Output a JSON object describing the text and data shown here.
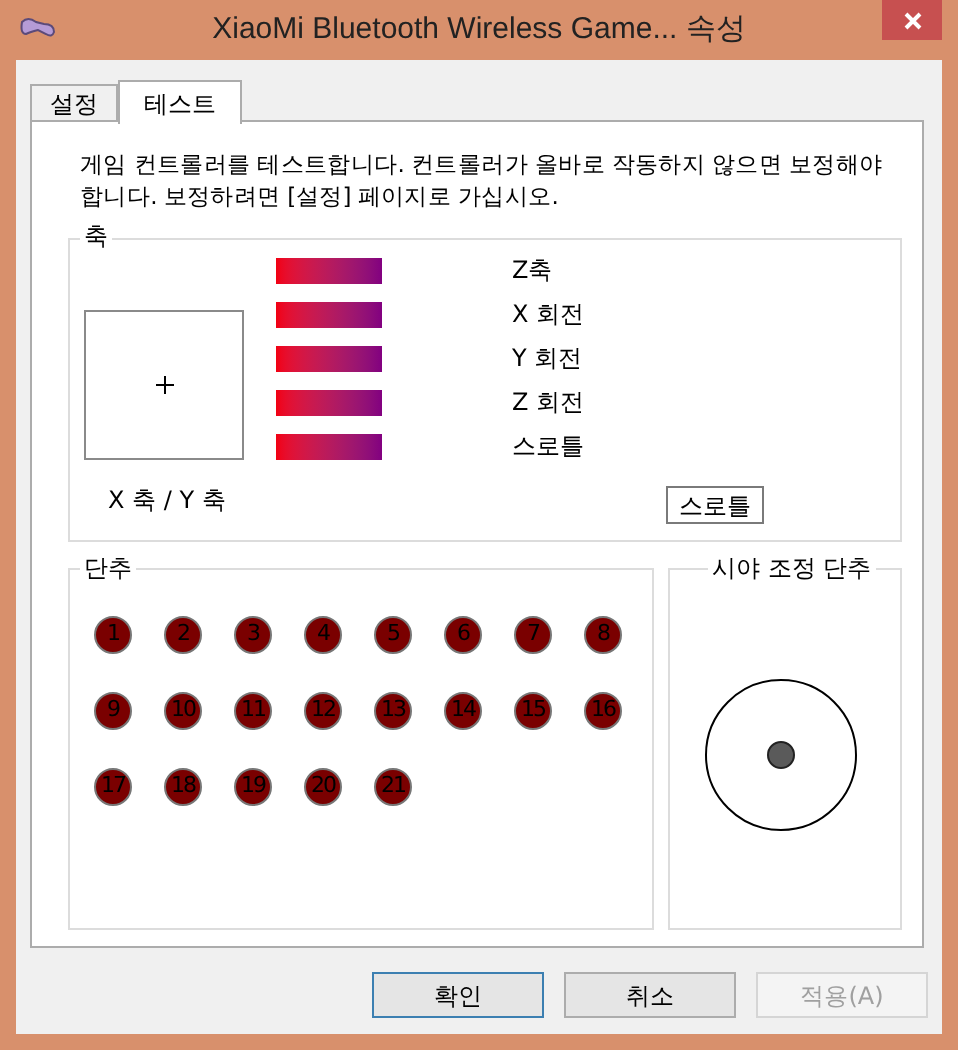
{
  "window": {
    "title": "XiaoMi Bluetooth Wireless Game... 속성"
  },
  "tabs": [
    {
      "label": "설정",
      "selected": false
    },
    {
      "label": "테스트",
      "selected": true
    }
  ],
  "description": "게임 컨트롤러를 테스트합니다. 컨트롤러가 올바로 작동하지 않으면 보정해야 합니다. 보정하려면 [설정] 페이지로 가십시오.",
  "axes": {
    "title": "축",
    "xy_label": "X 축 / Y 축",
    "meters": [
      {
        "name": "Z축"
      },
      {
        "name": "X 회전"
      },
      {
        "name": "Y 회전"
      },
      {
        "name": "Z 회전"
      },
      {
        "name": "스로틀"
      }
    ],
    "throttle_button": "스로틀"
  },
  "buttons_group": {
    "title": "단추",
    "buttons": [
      {
        "label": "1",
        "pressed": false
      },
      {
        "label": "2",
        "pressed": false
      },
      {
        "label": "3",
        "pressed": false
      },
      {
        "label": "4",
        "pressed": false
      },
      {
        "label": "5",
        "pressed": false
      },
      {
        "label": "6",
        "pressed": false
      },
      {
        "label": "7",
        "pressed": false
      },
      {
        "label": "8",
        "pressed": false
      },
      {
        "label": "9",
        "pressed": false
      },
      {
        "label": "10",
        "pressed": false
      },
      {
        "label": "11",
        "pressed": false
      },
      {
        "label": "12",
        "pressed": false
      },
      {
        "label": "13",
        "pressed": false
      },
      {
        "label": "14",
        "pressed": false
      },
      {
        "label": "15",
        "pressed": false
      },
      {
        "label": "16",
        "pressed": false
      },
      {
        "label": "17",
        "pressed": false
      },
      {
        "label": "18",
        "pressed": false
      },
      {
        "label": "19",
        "pressed": false
      },
      {
        "label": "20",
        "pressed": false
      },
      {
        "label": "21",
        "pressed": false
      }
    ]
  },
  "pov": {
    "title": "시야 조정 단추"
  },
  "dialog_buttons": [
    {
      "label": "확인",
      "default": true,
      "disabled": false
    },
    {
      "label": "취소",
      "default": false,
      "disabled": false
    },
    {
      "label": "적용(A)",
      "default": false,
      "disabled": true
    }
  ]
}
